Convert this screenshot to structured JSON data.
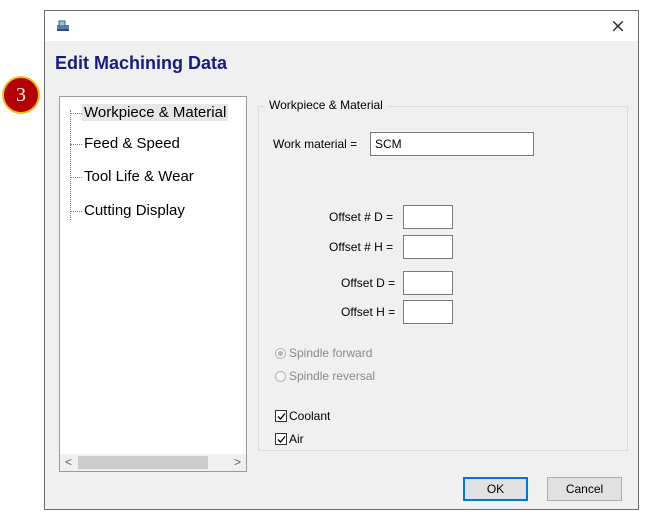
{
  "window": {
    "title": "",
    "close_glyph": "×"
  },
  "dialog": {
    "heading": "Edit Machining Data"
  },
  "step_badge": "3",
  "tree": {
    "items": [
      {
        "label": "Workpiece & Material",
        "selected": true
      },
      {
        "label": "Feed & Speed",
        "selected": false
      },
      {
        "label": "Tool Life & Wear",
        "selected": false
      },
      {
        "label": "Cutting Display",
        "selected": false
      }
    ],
    "scroll_left": "<",
    "scroll_right": ">"
  },
  "group": {
    "title": "Workpiece & Material",
    "work_material_label": "Work material =",
    "work_material_value": "SCM",
    "offset_num_d_label": "Offset # D =",
    "offset_num_d_value": "",
    "offset_num_h_label": "Offset # H =",
    "offset_num_h_value": "",
    "offset_d_label": "Offset D =",
    "offset_d_value": "",
    "offset_h_label": "Offset H =",
    "offset_h_value": "",
    "spindle_forward_label": "Spindle forward",
    "spindle_reversal_label": "Spindle reversal",
    "spindle_selected": "forward",
    "coolant_label": "Coolant",
    "coolant_checked": true,
    "air_label": "Air",
    "air_checked": true
  },
  "buttons": {
    "ok": "OK",
    "cancel": "Cancel"
  },
  "colors": {
    "heading": "#1a1a80",
    "badge": "#b40000",
    "badge_ring": "#f0c020",
    "default_button_border": "#0078d7"
  },
  "icons": {
    "app": "app-window-icon",
    "close": "close-icon",
    "check": "checkmark-icon"
  }
}
